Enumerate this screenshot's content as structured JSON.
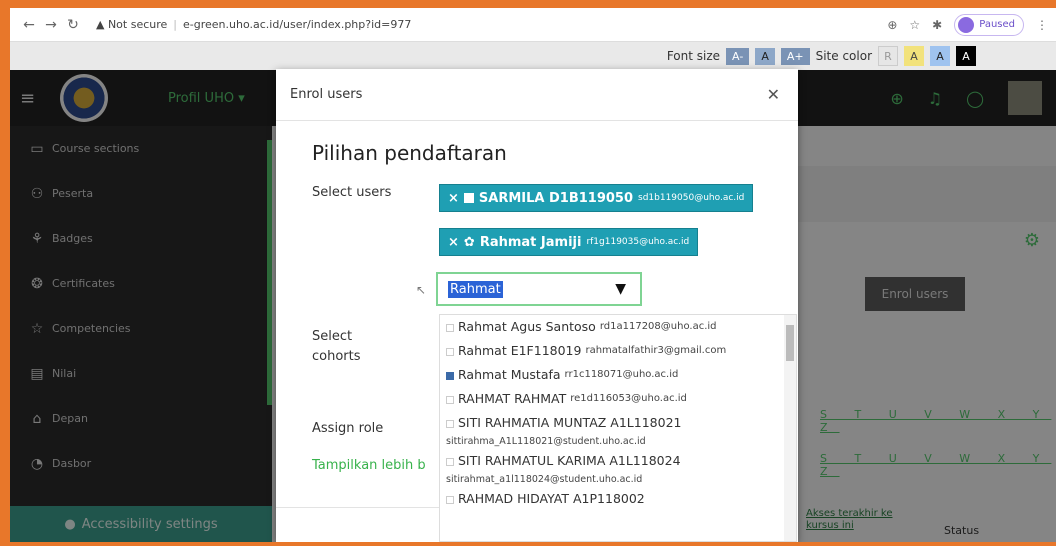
{
  "browser": {
    "url_warning": "▲ Not secure",
    "url": "e-green.uho.ac.id/user/index.php?id=977",
    "paused_label": "Paused"
  },
  "accessibility": {
    "font_size_label": "Font size",
    "font_buttons": [
      "A-",
      "A",
      "A+"
    ],
    "site_color_label": "Site color",
    "color_buttons": [
      "R",
      "A",
      "A",
      "A"
    ]
  },
  "header": {
    "site_menu": "Profil UHO ▾"
  },
  "sidebar": {
    "items": [
      {
        "label": "Course sections",
        "icon": "folder-icon"
      },
      {
        "label": "Peserta",
        "icon": "users-icon"
      },
      {
        "label": "Badges",
        "icon": "badge-icon"
      },
      {
        "label": "Certificates",
        "icon": "certificate-icon"
      },
      {
        "label": "Competencies",
        "icon": "competency-icon"
      },
      {
        "label": "Nilai",
        "icon": "grades-icon"
      },
      {
        "label": "Depan",
        "icon": "home-icon"
      },
      {
        "label": "Dasbor",
        "icon": "dashboard-icon"
      }
    ],
    "accessibility_settings": "Accessibility settings"
  },
  "background": {
    "enrol_button": "Enrol users",
    "letters_row": "S T U V W X Y Z",
    "col_access": "Akses terakhir ke kursus ini",
    "col_status": "Status"
  },
  "modal": {
    "title": "Enrol users",
    "section_title": "Pilihan pendaftaran",
    "select_users_label": "Select users",
    "chips": [
      {
        "name": "SARMILA D1B119050",
        "email": "sd1b119050@uho.ac.id"
      },
      {
        "name": "Rahmat Jamiji",
        "email": "rf1g119035@uho.ac.id"
      }
    ],
    "search_value": "Rahmat",
    "select_cohorts_label": "Select cohorts",
    "assign_role_label": "Assign role",
    "more_link": "Tampilkan lebih b",
    "options": [
      {
        "name": "Rahmat Agus Santoso",
        "email": "rd1a117208@uho.ac.id",
        "sub": ""
      },
      {
        "name": "Rahmat E1F118019",
        "email": "rahmatalfathir3@gmail.com",
        "sub": ""
      },
      {
        "name": "Rahmat Mustafa",
        "email": "rr1c118071@uho.ac.id",
        "sub": ""
      },
      {
        "name": "RAHMAT RAHMAT",
        "email": "re1d116053@uho.ac.id",
        "sub": ""
      },
      {
        "name": "SITI RAHMATIA MUNTAZ A1L118021",
        "email": "",
        "sub": "sittirahma_A1L118021@student.uho.ac.id"
      },
      {
        "name": "SITI RAHMATUL KARIMA A1L118024",
        "email": "",
        "sub": "sitirahmat_a1l118024@student.uho.ac.id"
      },
      {
        "name": "RAHMAD HIDAYAT A1P118002",
        "email": "",
        "sub": ""
      }
    ]
  }
}
